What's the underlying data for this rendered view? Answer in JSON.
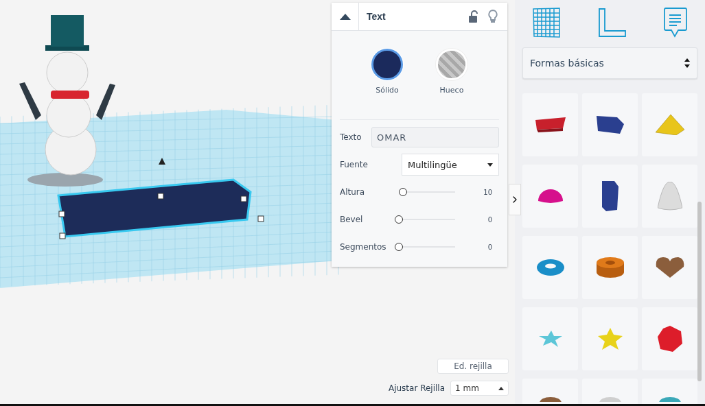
{
  "inspector": {
    "title": "Text",
    "modes": [
      {
        "label": "Sólido",
        "kind": "solid",
        "selected": true
      },
      {
        "label": "Hueco",
        "kind": "hole",
        "selected": false
      }
    ],
    "text_field": {
      "label": "Texto",
      "value": "OMAR"
    },
    "font_select": {
      "label": "Fuente",
      "value": "Multilingüe"
    },
    "sliders": [
      {
        "label": "Altura",
        "level": 0.07,
        "reading": "10"
      },
      {
        "label": "Bevel",
        "level": 0,
        "reading": "0"
      },
      {
        "label": "Segmentos",
        "level": 0,
        "reading": "0"
      }
    ]
  },
  "grid_controls": {
    "edit_button": "Ed. rejilla",
    "snap_label": "Ajustar Rejilla",
    "snap_value": "1 mm"
  },
  "library": {
    "category": "Formas básicas",
    "shapes": [
      {
        "kind": "text",
        "color": "#c8202c"
      },
      {
        "kind": "box",
        "color": "#2a3f8f"
      },
      {
        "kind": "pyramid",
        "color": "#e8c51a"
      },
      {
        "kind": "dome",
        "color": "#d6108c"
      },
      {
        "kind": "prism",
        "color": "#2a3f8f"
      },
      {
        "kind": "paraboloid",
        "color": "#dcdcdc"
      },
      {
        "kind": "torus",
        "color": "#1a8ec8"
      },
      {
        "kind": "tube",
        "color": "#e07a1a"
      },
      {
        "kind": "heart",
        "color": "#8b5e3c"
      },
      {
        "kind": "starflat",
        "color": "#5cc6d8"
      },
      {
        "kind": "star",
        "color": "#e8d21a"
      },
      {
        "kind": "polyhedron",
        "color": "#dd1d2a"
      },
      {
        "kind": "partial",
        "color": "#8b5e3c"
      },
      {
        "kind": "partial",
        "color": "#cfcfcf"
      },
      {
        "kind": "partial",
        "color": "#3aa8b8"
      }
    ]
  }
}
